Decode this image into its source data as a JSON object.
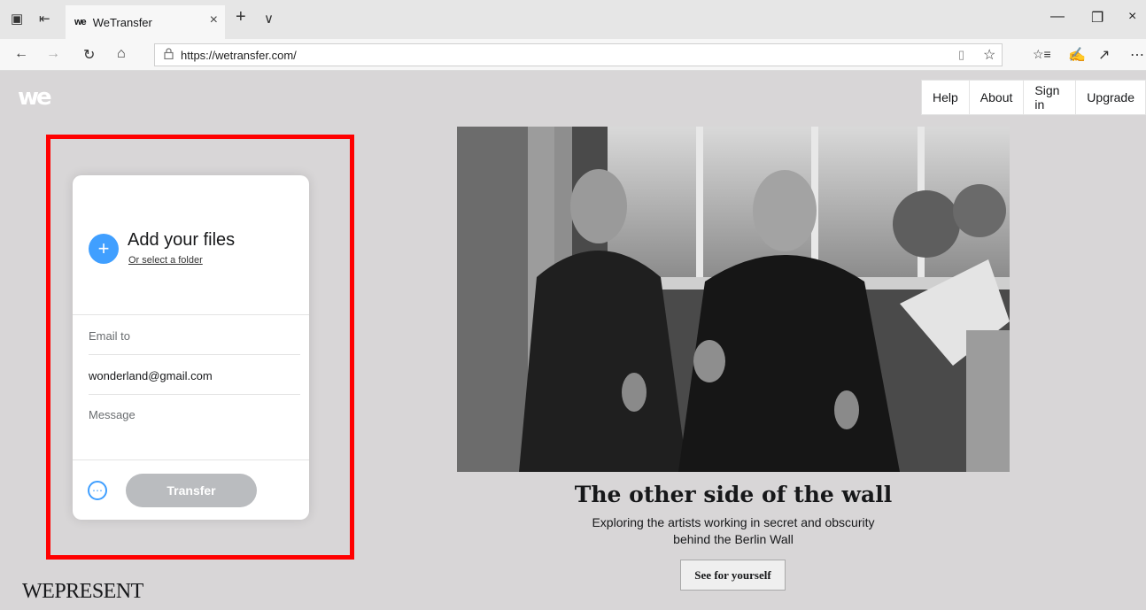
{
  "browser": {
    "tab_title": "WeTransfer",
    "tab_favicon": "we",
    "tab_close": "×",
    "new_tab": "+",
    "tab_menu": "∨",
    "url": "https://wetransfer.com/",
    "window": {
      "minimize": "—",
      "restore": "❐",
      "close": "×"
    },
    "icons": {
      "back": "←",
      "forward": "→",
      "refresh": "↻",
      "home": "⌂",
      "lock": "🔒",
      "reading_view": "▯",
      "favorite": "☆",
      "favorites_list": "☆≡",
      "pen": "✍",
      "share": "↗",
      "more": "⋯"
    }
  },
  "header": {
    "logo": "we",
    "nav": [
      {
        "label": "Help"
      },
      {
        "label": "About"
      },
      {
        "label": "Sign in"
      },
      {
        "label": "Upgrade"
      }
    ]
  },
  "upload_panel": {
    "add_icon": "+",
    "title": "Add your files",
    "select_folder": "Or select a folder",
    "email_to_placeholder": "Email to",
    "email_value": "wonderland@gmail.com",
    "message_placeholder": "Message",
    "options_icon": "⋯",
    "transfer_label": "Transfer"
  },
  "feature": {
    "headline": "The other side of the wall",
    "subline_1": "Exploring the artists working in secret and obscurity",
    "subline_2": "behind the Berlin Wall",
    "cta": "See for yourself"
  },
  "footer": {
    "brand": "WEPRESENT"
  },
  "colors": {
    "page_background": "#d8d6d7",
    "accent_blue": "#409fff",
    "transfer_disabled": "#babcbf",
    "highlight": "#ff0000"
  }
}
